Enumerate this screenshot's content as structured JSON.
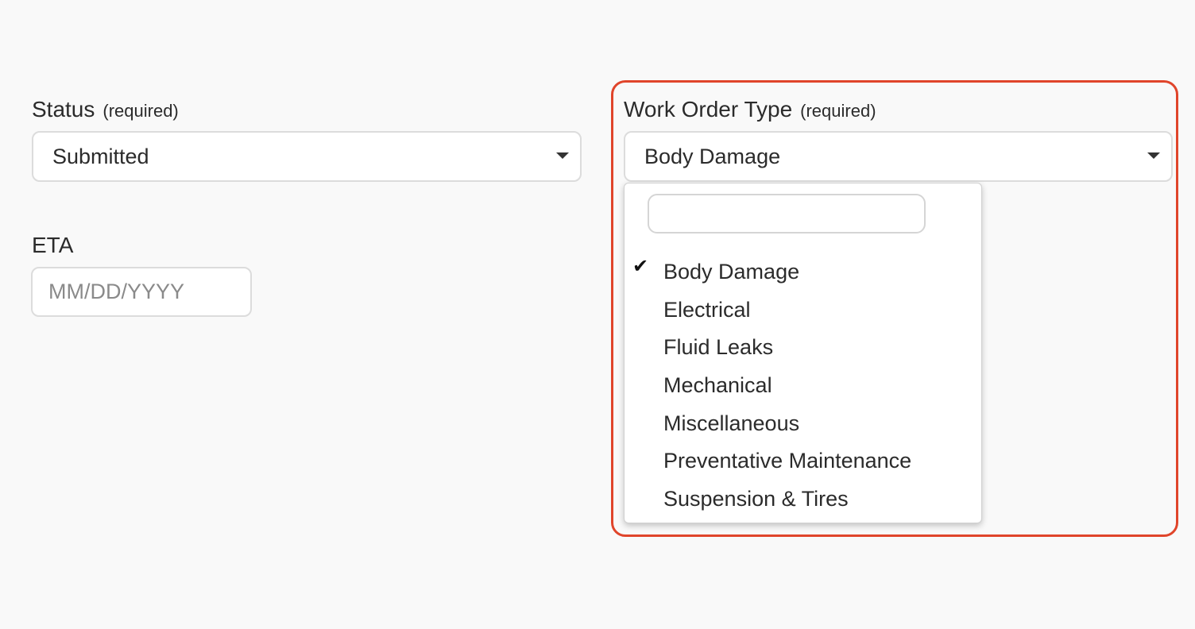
{
  "status": {
    "label": "Status",
    "required_text": "(required)",
    "value": "Submitted"
  },
  "eta": {
    "label": "ETA",
    "placeholder": "MM/DD/YYYY"
  },
  "work_order_type": {
    "label": "Work Order Type",
    "required_text": "(required)",
    "value": "Body Damage",
    "dropdown": {
      "search_value": "",
      "check_glyph": "✔",
      "options": [
        {
          "label": "Body Damage",
          "selected": true
        },
        {
          "label": "Electrical",
          "selected": false
        },
        {
          "label": "Fluid Leaks",
          "selected": false
        },
        {
          "label": "Mechanical",
          "selected": false
        },
        {
          "label": "Miscellaneous",
          "selected": false
        },
        {
          "label": "Preventative Maintenance",
          "selected": false
        },
        {
          "label": "Suspension & Tires",
          "selected": false
        }
      ]
    }
  },
  "colors": {
    "highlight_border": "#e0452b",
    "page_background": "#f9f9f9"
  }
}
